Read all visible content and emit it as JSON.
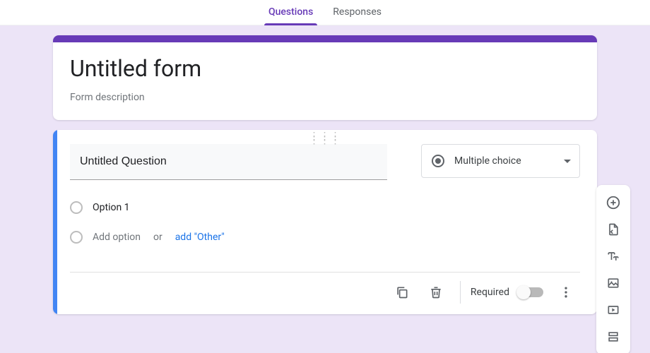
{
  "tabs": {
    "questions": "Questions",
    "responses": "Responses",
    "active": "questions"
  },
  "form": {
    "title": "Untitled form",
    "description": "Form description"
  },
  "question": {
    "title": "Untitled Question",
    "type_label": "Multiple choice",
    "options": [
      "Option 1"
    ],
    "add_option_label": "Add option",
    "or_label": "or",
    "add_other_label": "add \"Other\""
  },
  "footer": {
    "required_label": "Required",
    "required_on": false
  },
  "rail": {
    "add": "add-question",
    "import": "import-questions",
    "text": "add-title-description",
    "image": "add-image",
    "video": "add-video",
    "section": "add-section"
  },
  "colors": {
    "accent": "#673ab7",
    "active_border": "#4285f4",
    "link": "#1a73e8",
    "canvas": "#ece4f7"
  }
}
